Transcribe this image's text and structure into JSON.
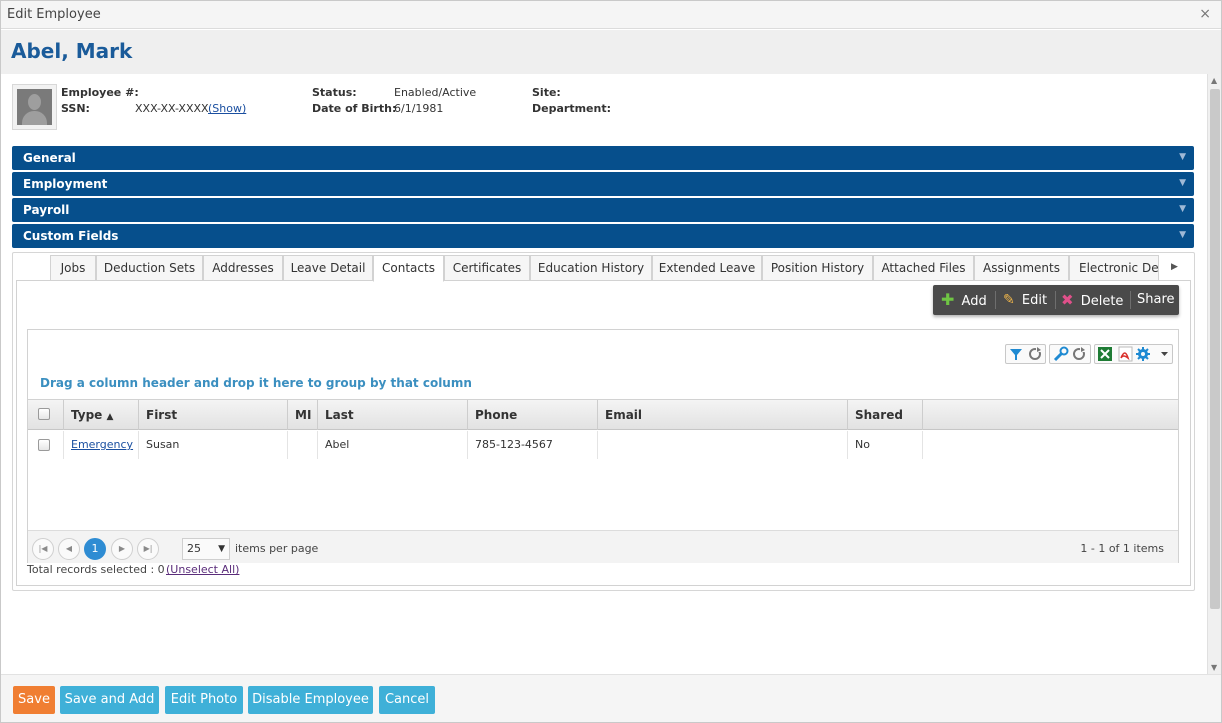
{
  "window": {
    "title": "Edit Employee",
    "close_glyph": "×"
  },
  "employee": {
    "name": "Abel, Mark",
    "employee_no_label": "Employee #:",
    "employee_no": "",
    "ssn_label": "SSN:",
    "ssn": "XXX-XX-XXXX",
    "ssn_show": "(Show)",
    "status_label": "Status:",
    "status": "Enabled/Active",
    "dob_label": "Date of Birth:",
    "dob": "6/1/1981",
    "site_label": "Site:",
    "site": "",
    "department_label": "Department:",
    "department": ""
  },
  "sections": [
    "General",
    "Employment",
    "Payroll",
    "Custom Fields"
  ],
  "tabs": [
    "Jobs",
    "Deduction Sets",
    "Addresses",
    "Leave Detail",
    "Contacts",
    "Certificates",
    "Education History",
    "Extended Leave",
    "Position History",
    "Attached Files",
    "Assignments",
    "Electronic Del"
  ],
  "active_tab": "Contacts",
  "toolbar": {
    "add": "Add",
    "edit": "Edit",
    "delete": "Delete",
    "share": "Share"
  },
  "grid": {
    "group_hint": "Drag a column header and drop it here to group by that column",
    "columns": [
      "Type",
      "First",
      "MI",
      "Last",
      "Phone",
      "Email",
      "Shared"
    ],
    "sort_indicator": "▲",
    "rows": [
      {
        "type": "Emergency",
        "first": "Susan",
        "mi": "",
        "last": "Abel",
        "phone": "785-123-4567",
        "email": "",
        "shared": "No"
      }
    ]
  },
  "pager": {
    "current_page": "1",
    "page_size": "25",
    "items_label": "items per page",
    "info": "1 - 1 of 1 items"
  },
  "selection": {
    "text": "Total records selected : 0",
    "unselect": "(Unselect All)"
  },
  "footer": {
    "save": "Save",
    "save_add": "Save and Add",
    "edit_photo": "Edit Photo",
    "disable": "Disable Employee",
    "cancel": "Cancel"
  },
  "colors": {
    "section": "#064f8c",
    "save": "#f07e32",
    "primary": "#3fb0d8",
    "pager_current": "#2e8cd3",
    "name": "#1a5b9a"
  }
}
